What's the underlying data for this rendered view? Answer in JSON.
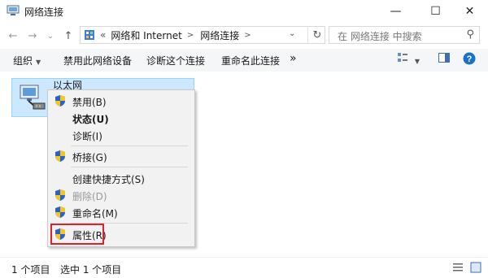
{
  "window": {
    "title": "网络连接",
    "controls": {
      "minimize": "—",
      "maximize": "☐",
      "close": "✕"
    }
  },
  "nav": {
    "back_glyph": "←",
    "forward_glyph": "→",
    "history_glyph": "⌄",
    "up_glyph": "↑"
  },
  "address": {
    "overflow": "«",
    "crumbs": [
      "网络和 Internet",
      "网络连接"
    ],
    "separator": ">",
    "dropdown_glyph": "⌄",
    "refresh_glyph": "↻"
  },
  "search": {
    "placeholder": "在 网络连接 中搜索",
    "icon_glyph": "⚲"
  },
  "toolbar": {
    "organize": "组织",
    "disable": "禁用此网络设备",
    "diagnose": "诊断这个连接",
    "rename": "重命名此连接",
    "more": "»"
  },
  "item": {
    "name": "以太网"
  },
  "context_menu": {
    "items": [
      {
        "label": "禁用(B)",
        "icon": "shield-icon",
        "state": "normal"
      },
      {
        "label": "状态(U)",
        "icon": "",
        "state": "bold"
      },
      {
        "label": "诊断(I)",
        "icon": "",
        "state": "normal"
      },
      {
        "label": "桥接(G)",
        "icon": "shield-icon",
        "state": "normal"
      },
      {
        "label": "创建快捷方式(S)",
        "icon": "",
        "state": "normal"
      },
      {
        "label": "删除(D)",
        "icon": "shield-icon",
        "state": "disabled"
      },
      {
        "label": "重命名(M)",
        "icon": "shield-icon",
        "state": "normal"
      },
      {
        "label": "属性(R)",
        "icon": "shield-icon",
        "state": "normal"
      }
    ],
    "highlight_color": "#e0202c"
  },
  "status": {
    "count": "1 个项目",
    "selected": "选中 1 个项目"
  },
  "colors": {
    "selection_bg": "#cce8ff",
    "selection_border": "#99d1ff",
    "help_blue": "#1a73c9"
  }
}
